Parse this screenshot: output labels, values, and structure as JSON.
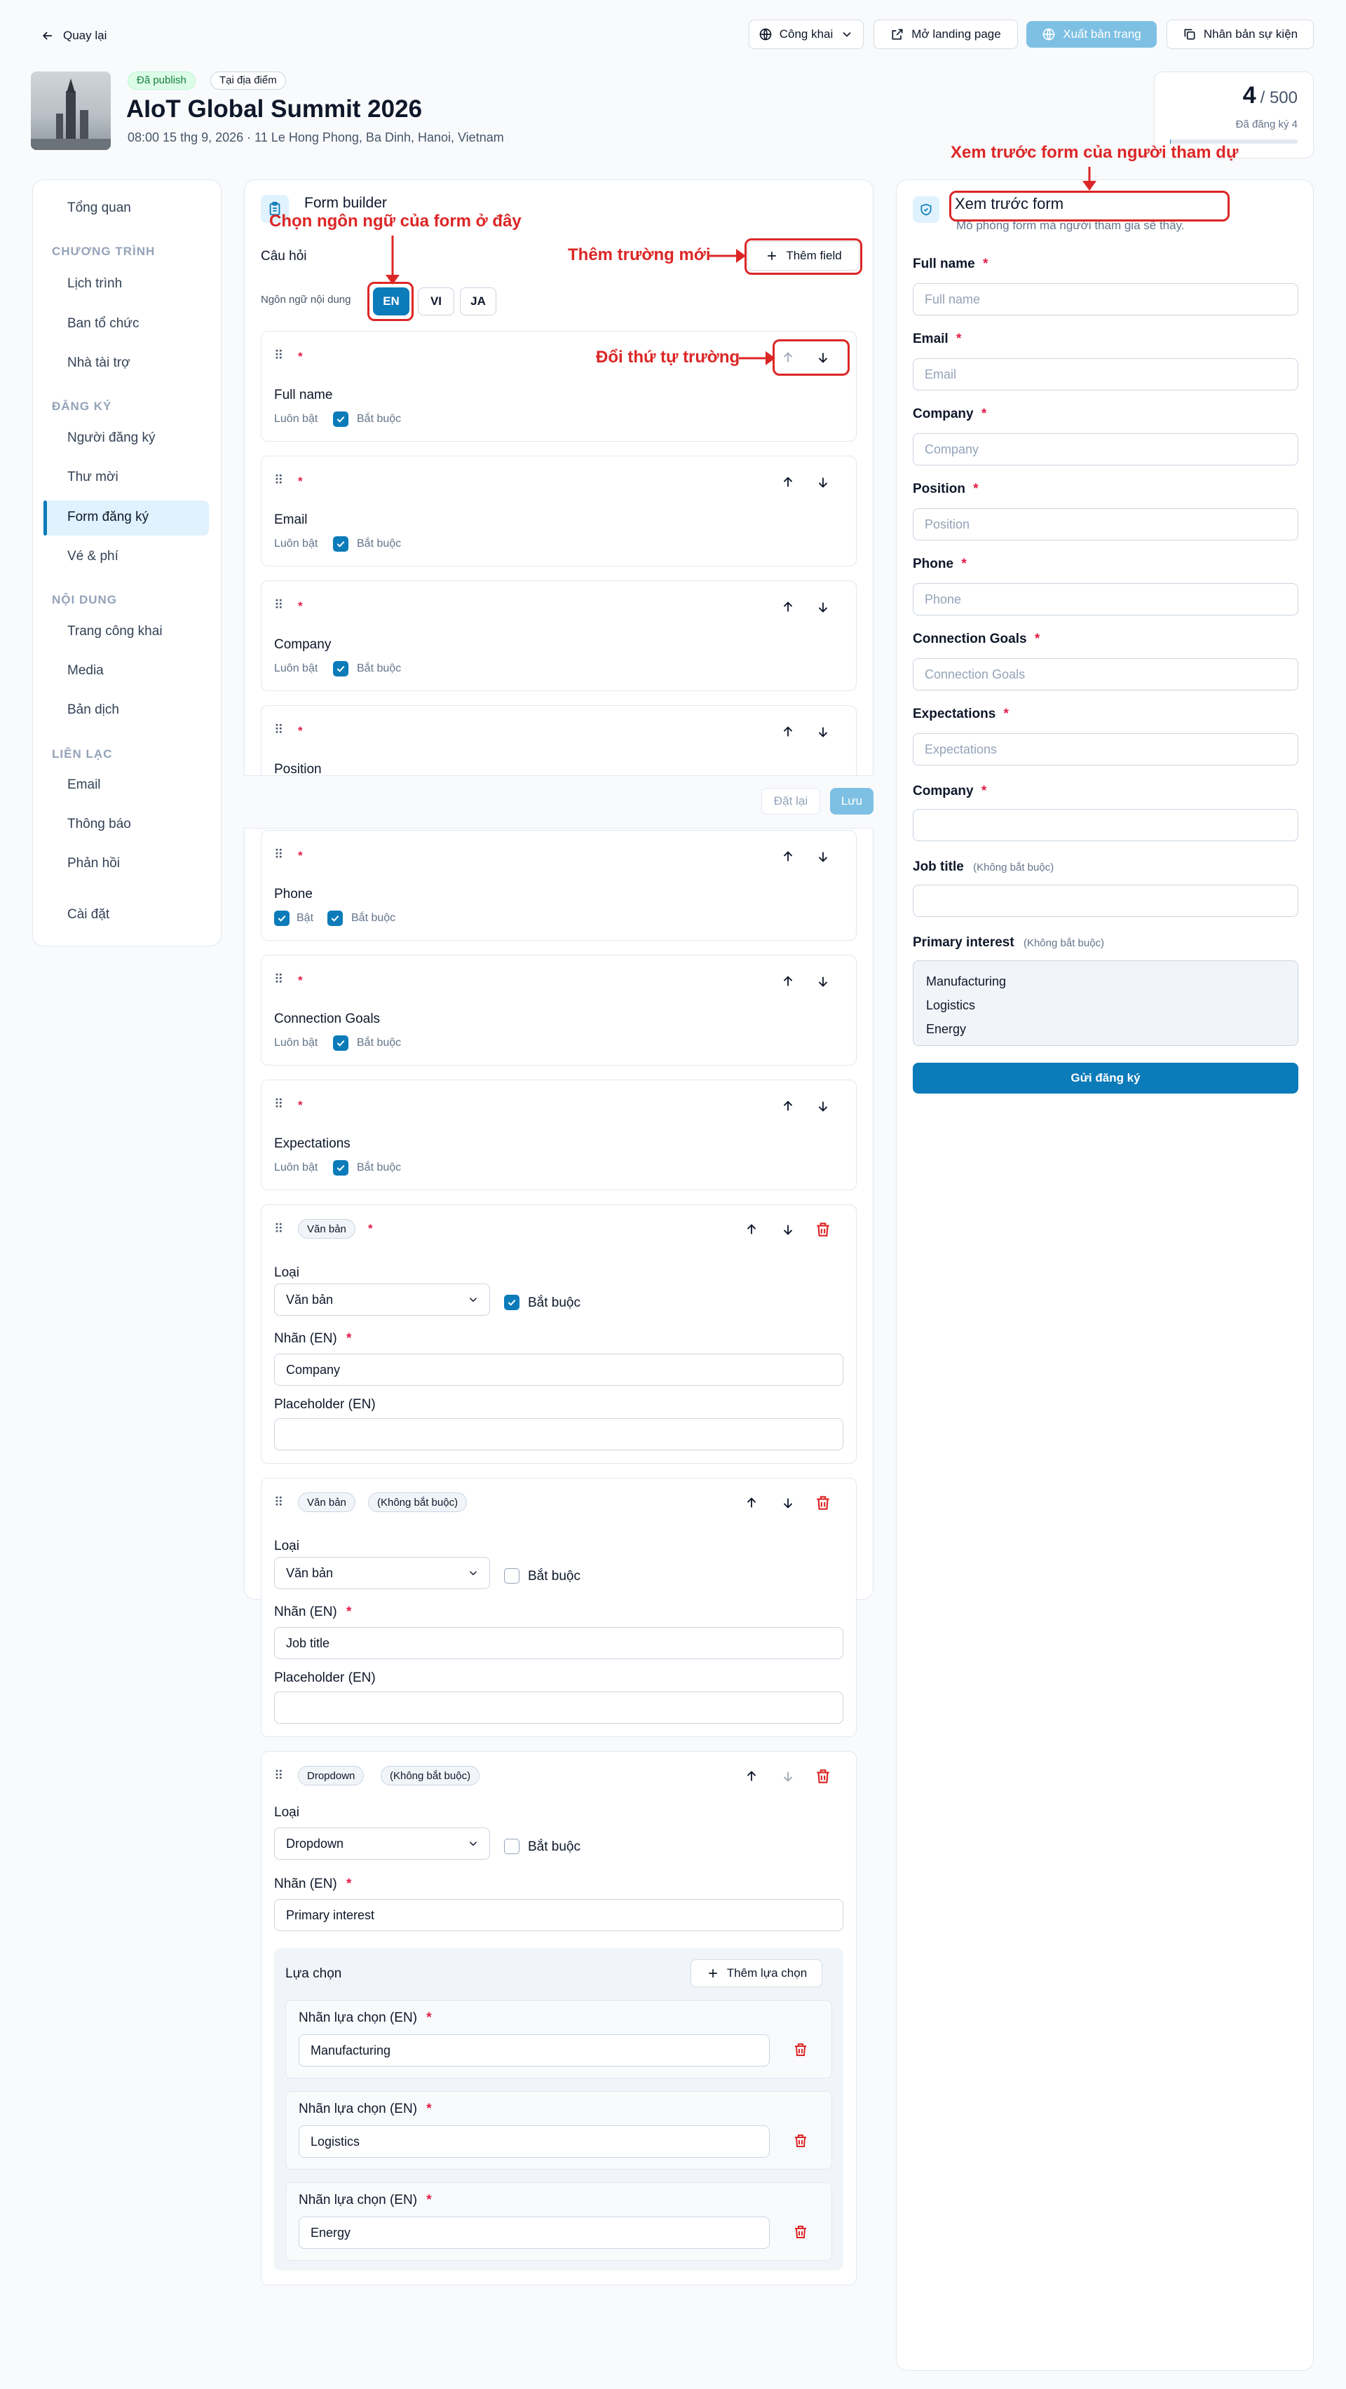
{
  "header": {
    "back_label": "Quay lại",
    "visibility_label": "Công khai",
    "open_landing_label": "Mở landing page",
    "export_label": "Xuất bản trang",
    "duplicate_label": "Nhân bản sự kiện"
  },
  "event": {
    "status_badge": "Đã publish",
    "location_badge": "Tại địa điểm",
    "title": "AIoT Global Summit 2026",
    "subtitle": "08:00 15 thg 9, 2026 · 11 Le Hong Phong, Ba Dinh, Hanoi, Vietnam",
    "registered_count": "4",
    "capacity": "/ 500",
    "registered_label": "Đã đăng ký 4",
    "capacity_fill_fraction": 0.008
  },
  "sidebar": {
    "overview": "Tổng quan",
    "sec_program": "CHƯƠNG TRÌNH",
    "schedule": "Lịch trình",
    "organizers": "Ban tổ chức",
    "sponsors": "Nhà tài trợ",
    "sec_registration": "ĐĂNG KÝ",
    "registrants": "Người đăng ký",
    "invitations": "Thư mời",
    "reg_form": "Form đăng ký",
    "tickets": "Vé & phí",
    "sec_content": "NỘI DUNG",
    "public_page": "Trang công khai",
    "media": "Media",
    "translation": "Bản dịch",
    "sec_contact": "LIÊN LẠC",
    "email": "Email",
    "notifications": "Thông báo",
    "feedback": "Phản hồi",
    "settings": "Cài đặt"
  },
  "builder": {
    "title": "Form builder",
    "questions_label": "Câu hỏi",
    "add_field_label": "Thêm field",
    "content_lang_label": "Ngôn ngữ nội dung",
    "langs": [
      "EN",
      "VI",
      "JA"
    ],
    "always_on": "Luôn bật",
    "required": "Bắt buộc",
    "enabled": "Bật",
    "reset_label": "Đặt lại",
    "save_label": "Lưu",
    "fields_simple": [
      "Full name",
      "Email",
      "Company",
      "Position",
      "Phone",
      "Connection Goals",
      "Expectations"
    ],
    "type_label": "Loại",
    "label_en": "Nhãn (EN)",
    "placeholder_en": "Placeholder (EN)",
    "type_text": "Văn bản",
    "type_dropdown": "Dropdown",
    "optional_tag": "(Không bắt buộc)",
    "custom1_label": "Company",
    "custom2_label": "Job title",
    "custom3_label": "Primary interest",
    "options_title": "Lựa chọn",
    "add_option_label": "Thêm lựa chọn",
    "option_label_en": "Nhãn lựa chọn (EN)",
    "options": [
      "Manufacturing",
      "Logistics",
      "Energy"
    ]
  },
  "preview": {
    "title": "Xem trước form",
    "subtitle": "Mô phỏng form mà người tham gia sẽ thấy.",
    "fields": [
      "Full name",
      "Email",
      "Company",
      "Position",
      "Phone",
      "Connection Goals",
      "Expectations"
    ],
    "company_label": "Company",
    "job_title_label": "Job title",
    "optional_note": "(Không bắt buộc)",
    "primary_interest_label": "Primary interest",
    "options": [
      "Manufacturing",
      "Logistics",
      "Energy"
    ],
    "submit_label": "Gửi đăng ký"
  },
  "annotations": {
    "choose_lang": "Chọn ngôn ngữ của form ở đây",
    "add_field": "Thêm trường mới",
    "reorder": "Đổi thứ tự trường",
    "preview_form": "Xem trước form của người tham dự"
  },
  "colors": {
    "primary": "#0b7bb9",
    "annotation_red": "#dc2626",
    "required_red": "#e11d48"
  }
}
